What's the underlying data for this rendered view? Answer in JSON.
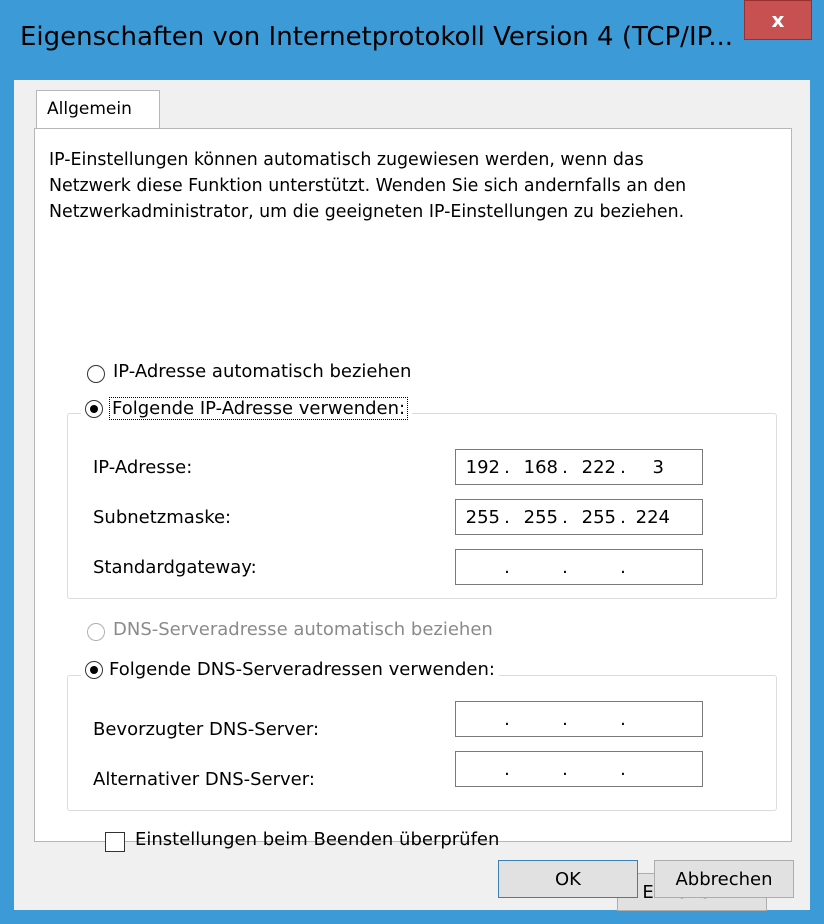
{
  "window": {
    "title": "Eigenschaften von Internetprotokoll Version 4 (TCP/IP...",
    "close_label": "x"
  },
  "tabs": [
    {
      "label": "Allgemein"
    }
  ],
  "intro_text": "IP-Einstellungen können automatisch zugewiesen werden, wenn das\nNetzwerk diese Funktion unterstützt. Wenden Sie sich andernfalls an den\nNetzwerkadministrator, um die geeigneten IP-Einstellungen zu beziehen.",
  "ip_mode": {
    "auto_label": "IP-Adresse automatisch beziehen",
    "manual_label": "Folgende IP-Adresse verwenden:",
    "selected": "manual"
  },
  "ip_fields": {
    "ip_label": "IP-Adresse:",
    "ip_value": [
      "192",
      "168",
      "222",
      "3"
    ],
    "subnet_label": "Subnetzmaske:",
    "subnet_value": [
      "255",
      "255",
      "255",
      "224"
    ],
    "gateway_label": "Standardgateway:",
    "gateway_value": [
      "",
      "",
      "",
      ""
    ]
  },
  "dns_mode": {
    "auto_label": "DNS-Serveradresse automatisch beziehen",
    "manual_label": "Folgende DNS-Serveradressen verwenden:",
    "selected": "manual",
    "auto_disabled": true
  },
  "dns_fields": {
    "preferred_label": "Bevorzugter DNS-Server:",
    "preferred_value": [
      "",
      "",
      "",
      ""
    ],
    "alternate_label": "Alternativer DNS-Server:",
    "alternate_value": [
      "",
      "",
      "",
      ""
    ]
  },
  "validate_checkbox": {
    "label": "Einstellungen beim Beenden überprüfen",
    "checked": false
  },
  "buttons": {
    "advanced": "Erweitert...",
    "ok": "OK",
    "cancel": "Abbrechen"
  },
  "colors": {
    "title_bar": "#3c9bd6",
    "close_button": "#c75050"
  }
}
